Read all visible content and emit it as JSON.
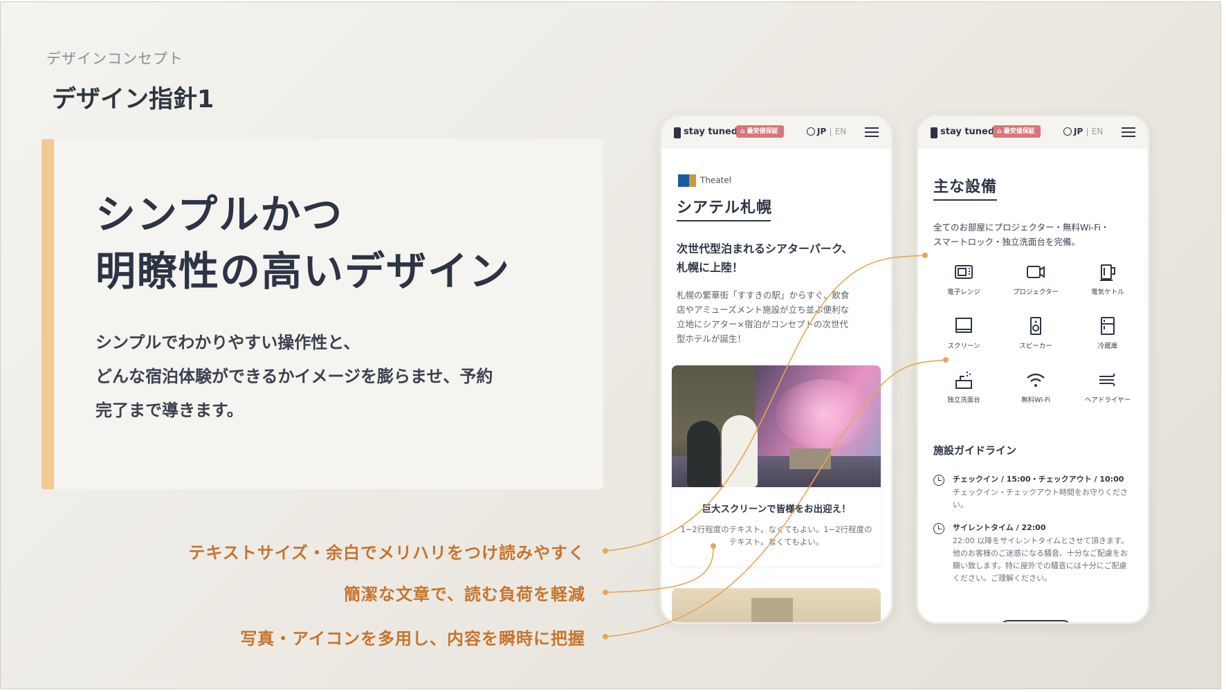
{
  "slide": {
    "eyebrow": "デザインコンセプト",
    "title": "デザイン指針1"
  },
  "concept": {
    "headline_lines": [
      "シンプルかつ",
      "明瞭性の高いデザイン"
    ],
    "body_lines": [
      "シンプルでわかりやすい操作性と、",
      "どんな宿泊体験ができるかイメージを膨らませ、予約",
      "完了まで導きます。"
    ],
    "accent_color": "#f2c995"
  },
  "annotations": [
    "テキストサイズ・余白でメリハリをつけ読みやすく",
    "簡潔な文章で、読む負荷を軽減",
    "写真・アイコンを多用し、内容を瞬時に把握"
  ],
  "phone_header": {
    "logo_text": "stay tuned",
    "badge": "最安値保証",
    "lang_jp": "JP",
    "lang_sep": "|",
    "lang_en": "EN"
  },
  "phone1": {
    "brand_logo": "Theatel",
    "hotel_name": "シアテル札幌",
    "catch_lines": [
      "次世代型泊まれるシアターパーク、",
      "札幌に上陸！"
    ],
    "desc_lines": [
      "札幌の繁華街「すすきの駅」からすぐ、飲食",
      "店やアミューズメント施設が立ち並ぶ便利な",
      "立地にシアター×宿泊がコンセプトの次世代",
      "型ホテルが誕生！"
    ],
    "feature_title": "巨大スクリーンで皆様をお出迎え！",
    "feature_text": "1~2行程度のテキスト。なくてもよい。1~2行程度のテキスト。なくてもよい。"
  },
  "phone2": {
    "section_title": "主な設備",
    "section_desc_lines": [
      "全てのお部屋にプロジェクター・無料Wi-Fi・",
      "スマートロック・独立洗面台を完備。"
    ],
    "amenities": [
      {
        "label": "電子レンジ",
        "icon": "microwave-icon"
      },
      {
        "label": "プロジェクター",
        "icon": "projector-icon"
      },
      {
        "label": "電気ケトル",
        "icon": "kettle-icon"
      },
      {
        "label": "スクリーン",
        "icon": "screen-icon"
      },
      {
        "label": "スピーカー",
        "icon": "speaker-icon"
      },
      {
        "label": "冷蔵庫",
        "icon": "fridge-icon"
      },
      {
        "label": "独立洗面台",
        "icon": "washbasin-icon"
      },
      {
        "label": "無料Wi-Fi",
        "icon": "wifi-icon"
      },
      {
        "label": "ヘアドライヤー",
        "icon": "hairdryer-icon"
      }
    ],
    "guide_title": "施設ガイドライン",
    "guides": [
      {
        "head": "チェックイン / 15:00・チェックアウト / 10:00",
        "body": "チェックイン・チェックアウト時間をお守りください。"
      },
      {
        "head": "サイレントタイム / 22:00",
        "body": "22:00 以降をサイレントタイムとさせて頂きます。他のお客様のご迷惑になる騒音、十分なご配慮をお願い致します。特に屋外での騒音には十分にご配慮ください。ご理解ください。"
      }
    ]
  },
  "colors": {
    "annotation": "#c7742d",
    "connector": "#e9a552",
    "text_dark": "#2c3445",
    "badge": "#d8767a"
  }
}
